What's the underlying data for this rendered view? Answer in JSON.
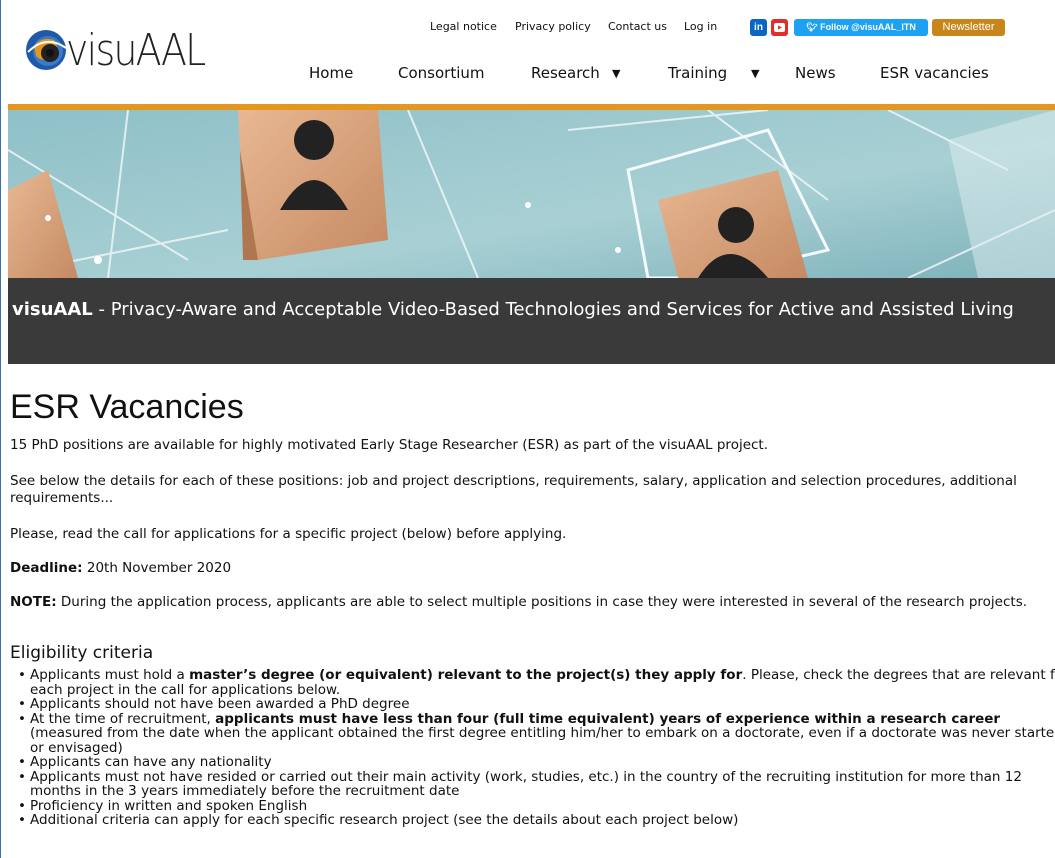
{
  "site": {
    "logo_text": "visuAAL"
  },
  "topnav": {
    "legal": "Legal notice",
    "privacy": "Privacy policy",
    "contact": "Contact us",
    "login": "Log in",
    "linkedin": "in",
    "twitter_follow": "Follow @visuAAL_ITN",
    "newsletter": "Newsletter"
  },
  "mainnav": {
    "home": "Home",
    "consortium": "Consortium",
    "research": "Research",
    "training": "Training",
    "news": "News",
    "vacancies": "ESR vacancies",
    "caret": "▼"
  },
  "colors": {
    "accent_orange": "#e4971f",
    "title_bar": "#3a3a3a",
    "linkedin": "#0a66c2",
    "youtube": "#e52d27",
    "twitter": "#1da1f2",
    "newsletter": "#c8861a"
  },
  "project_title": {
    "name": "visuAAL",
    "rest": " - Privacy-Aware and Acceptable Video-Based Technologies and Services for Active and Assisted Living"
  },
  "page": {
    "heading": "ESR Vacancies",
    "p1": "15 PhD positions are available for highly motivated Early Stage Researcher (ESR) as part of the visuAAL project.",
    "p2": "See below the details for each of these positions: job and project descriptions, requirements, salary, application and selection procedures, additional requirements...",
    "p3": "Please, read the call for applications for a specific project (below) before applying.",
    "deadline_label": "Deadline:",
    "deadline_value": " 20th November 2020",
    "note_label": "NOTE:",
    "note_text": " During the application process, applicants are able to select multiple positions in case they were interested in several of the research projects.",
    "eligibility_heading": "Eligibility criteria"
  },
  "criteria": {
    "c1_a": "Applicants must hold a ",
    "c1_b": "master’s degree (or equivalent) relevant to the project(s) they apply for",
    "c1_c": ". Please, check the degrees that are relevant for each project in the call for applications below.",
    "c2": "Applicants should not have been awarded a PhD degree",
    "c3_a": "At the time of recruitment, ",
    "c3_b": "applicants must have less than four (full time equivalent) years of experience within a research career",
    "c3_c": " (measured from the date when the applicant obtained the first degree entitling him/her to embark on a doctorate, even if a doctorate was never started or envisaged)",
    "c4": "Applicants can have any nationality",
    "c5": "Applicants must not have resided or carried out their main activity (work, studies, etc.) in the country of the recruiting institution for more than 12 months in the 3 years immediately before the recruitment date",
    "c6": "Proficiency in written and spoken English",
    "c7": "Additional criteria can apply for each specific research project (see the details about each project below)"
  }
}
